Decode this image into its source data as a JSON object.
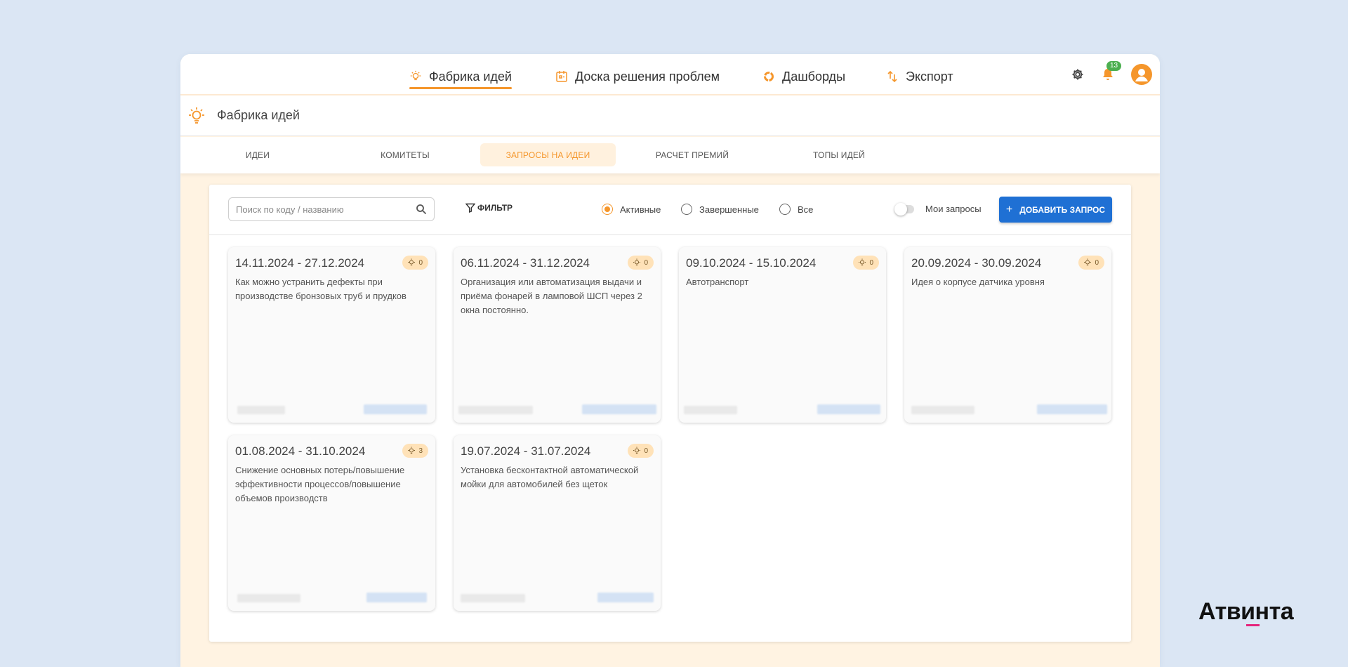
{
  "topnav": {
    "items": [
      {
        "label": "Фабрика идей",
        "icon": "lightbulb-icon",
        "active": true
      },
      {
        "label": "Доска решения проблем",
        "icon": "board-icon",
        "active": false
      },
      {
        "label": "Дашборды",
        "icon": "donut-chart-icon",
        "active": false
      },
      {
        "label": "Экспорт",
        "icon": "export-arrows-icon",
        "active": false
      }
    ],
    "notifications_count": "13"
  },
  "subheader": {
    "title": "Фабрика идей",
    "icon": "lightbulb-icon"
  },
  "tabs": [
    {
      "label": "ИДЕИ",
      "active": false
    },
    {
      "label": "КОМИТЕТЫ",
      "active": false
    },
    {
      "label": "ЗАПРОСЫ НА ИДЕИ",
      "active": true
    },
    {
      "label": "РАСЧЕТ ПРЕМИЙ",
      "active": false
    },
    {
      "label": "ТОПЫ ИДЕЙ",
      "active": false
    }
  ],
  "toolbar": {
    "search_placeholder": "Поиск по коду / названию",
    "filter_label": "ФИЛЬТР",
    "radios": [
      {
        "label": "Активные",
        "selected": true
      },
      {
        "label": "Завершенные",
        "selected": false
      },
      {
        "label": "Все",
        "selected": false
      }
    ],
    "my_requests_label": "Мои запросы",
    "add_button_label": "ДОБАВИТЬ ЗАПРОС"
  },
  "cards": [
    {
      "dates": "14.11.2024 - 27.12.2024",
      "ideas": "0",
      "description": "Как можно устранить дефекты при производстве бронзовых труб и прудков"
    },
    {
      "dates": "06.11.2024 - 31.12.2024",
      "ideas": "0",
      "description": "Организация или автоматизация выдачи и приёма фонарей в ламповой ШСП через 2 окна постоянно."
    },
    {
      "dates": "09.10.2024 - 15.10.2024",
      "ideas": "0",
      "description": "Автотранспорт"
    },
    {
      "dates": "20.09.2024 - 30.09.2024",
      "ideas": "0",
      "description": "Идея о корпусе датчика уровня"
    },
    {
      "dates": "01.08.2024 - 31.10.2024",
      "ideas": "3",
      "description": "Снижение основных потерь/повышение эффективности процессов/повышение объемов производств"
    },
    {
      "dates": "19.07.2024 - 31.07.2024",
      "ideas": "0",
      "description": "Установка бесконтактной автоматической мойки для автомобилей без щеток"
    }
  ],
  "brand": {
    "name": "Атвинта",
    "accent": "#e5247b"
  },
  "colors": {
    "accent": "#f5962b",
    "primary": "#1f70d4",
    "background": "#dbe6f4",
    "app_bg": "#fff3e2"
  }
}
